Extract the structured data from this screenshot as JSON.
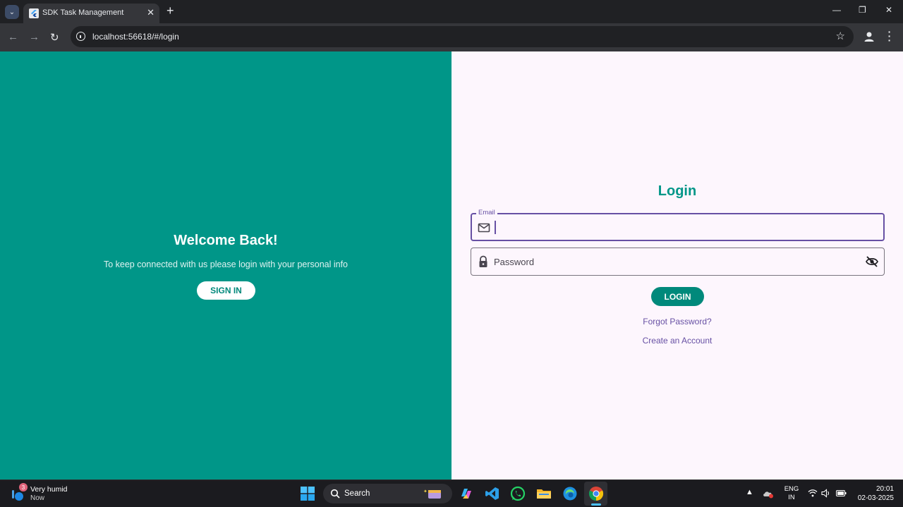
{
  "browser": {
    "tab_title": "SDK Task Management",
    "url": "localhost:56618/#/login"
  },
  "welcome": {
    "title": "Welcome Back!",
    "subtitle": "To keep connected with us please login with your personal info",
    "signin_label": "SIGN IN"
  },
  "login": {
    "title": "Login",
    "email_label": "Email",
    "email_value": "",
    "password_placeholder": "Password",
    "login_label": "LOGIN",
    "forgot_label": "Forgot Password?",
    "create_label": "Create an Account"
  },
  "taskbar": {
    "weather_badge": "3",
    "weather_text": "Very humid",
    "weather_sub": "Now",
    "search_label": "Search",
    "lang_top": "ENG",
    "lang_bottom": "IN",
    "time": "20:01",
    "date": "02-03-2025"
  },
  "icons": {
    "tab_menu": "chevron-down-icon",
    "favicon": "flutter-icon",
    "tab_close": "close-icon",
    "new_tab": "plus-icon",
    "back": "arrow-left-icon",
    "forward": "arrow-right-icon",
    "reload": "reload-icon",
    "site_info": "info-icon",
    "bookmark": "star-icon",
    "profile": "person-icon",
    "menu": "more-vertical-icon",
    "email": "mail-icon",
    "password": "lock-icon",
    "visibility": "eye-off-icon"
  },
  "colors": {
    "teal_panel": "#009688",
    "teal_button": "#00897b",
    "focus_purple": "#6750a4",
    "right_bg": "#fdf6fd"
  }
}
